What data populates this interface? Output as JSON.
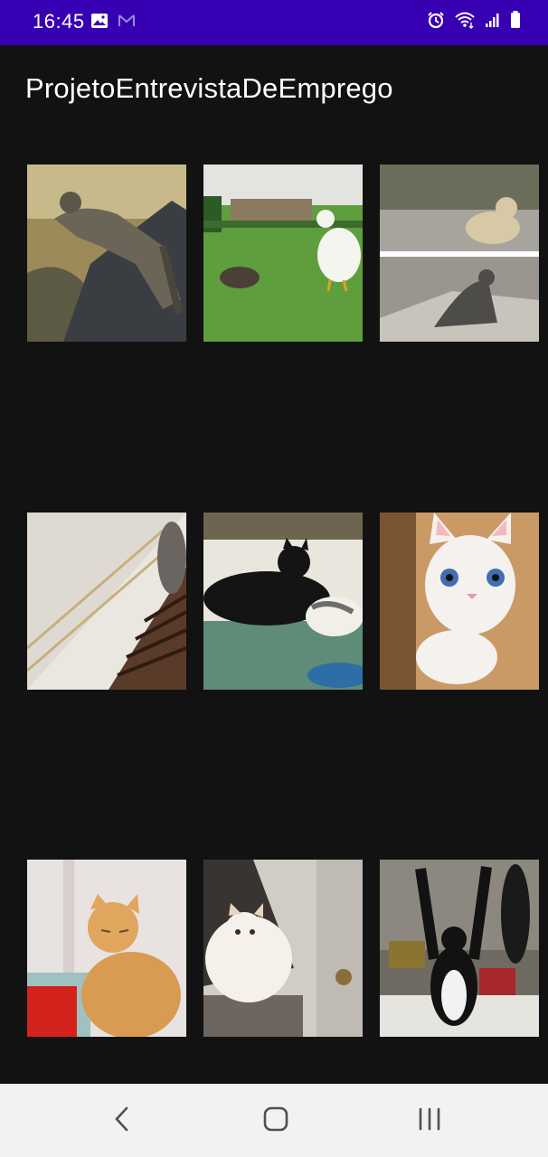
{
  "status_bar": {
    "time": "16:45",
    "left_icons": [
      "image-icon",
      "gmail-icon"
    ],
    "right_icons": [
      "alarm-icon",
      "wifi-icon",
      "signal-icon",
      "battery-icon"
    ],
    "background": "#3700b3"
  },
  "app_bar": {
    "title": "ProjetoEntrevistaDeEmprego"
  },
  "grid": {
    "columns": 3,
    "items": [
      {
        "subject": "wild cat on rock"
      },
      {
        "subject": "kitten and duck on grass"
      },
      {
        "subject": "cat statues on street"
      },
      {
        "subject": "cat on rope bridge"
      },
      {
        "subject": "black cat lying with calico cat"
      },
      {
        "subject": "white cat with blue eyes"
      },
      {
        "subject": "orange tabby cat"
      },
      {
        "subject": "white fluffy cat"
      },
      {
        "subject": "black and white cat standing"
      }
    ]
  },
  "nav_bar": {
    "buttons": [
      "back-icon",
      "home-icon",
      "recents-icon"
    ],
    "background": "#f2f2f2"
  }
}
